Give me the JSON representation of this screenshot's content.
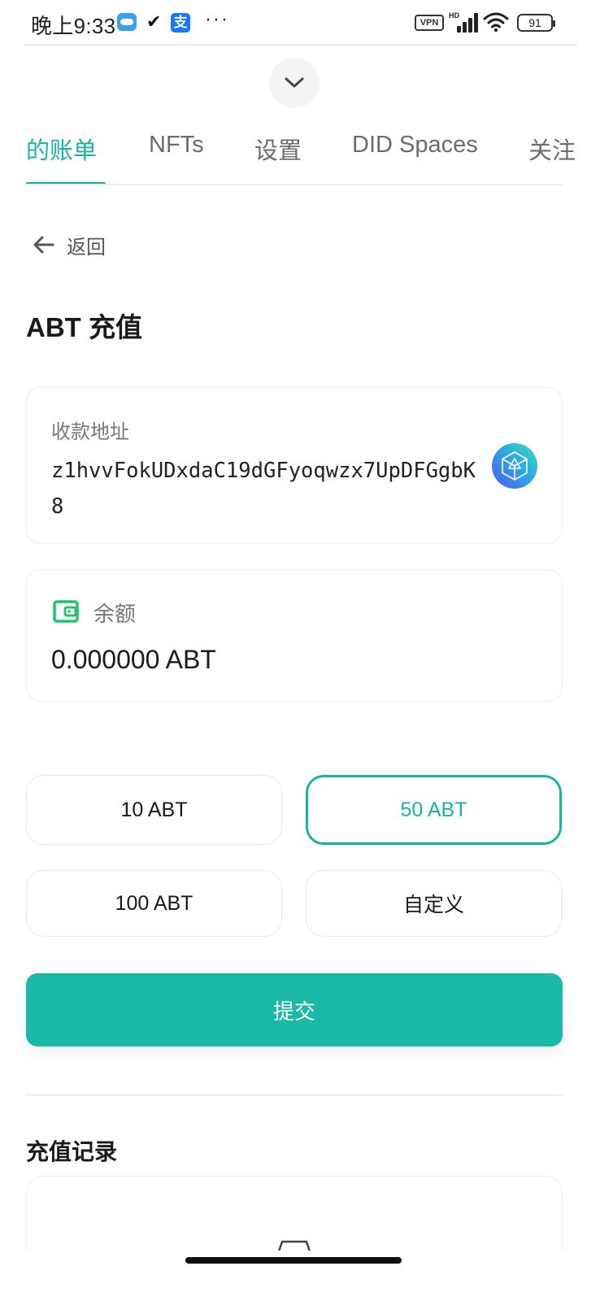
{
  "status_bar": {
    "time": "晚上9:33",
    "alipay_glyph": "支",
    "vpn": "VPN",
    "hd": "HD",
    "battery": "91"
  },
  "tabs": [
    {
      "label": "的账单",
      "active": true
    },
    {
      "label": "NFTs",
      "active": false
    },
    {
      "label": "设置",
      "active": false
    },
    {
      "label": "DID Spaces",
      "active": false
    },
    {
      "label": "关注",
      "active": false
    }
  ],
  "back_label": "返回",
  "page_title": "ABT 充值",
  "address": {
    "label": "收款地址",
    "value": "z1hvvFokUDxdaC19dGFyoqwzx7UpDFGgbK8"
  },
  "balance": {
    "label": "余额",
    "value": "0.000000 ABT"
  },
  "amount_options": [
    {
      "label": "10 ABT",
      "selected": false
    },
    {
      "label": "50 ABT",
      "selected": true
    },
    {
      "label": "100 ABT",
      "selected": false
    },
    {
      "label": "自定义",
      "selected": false
    }
  ],
  "submit_label": "提交",
  "history_title": "充值记录",
  "colors": {
    "accent": "#19b3a3",
    "submit": "#1ab8a6",
    "wallet_icon": "#22c36a"
  },
  "icons": {
    "collapse": "chevron-down-icon",
    "back": "arrow-left-icon",
    "address": "did-icon",
    "balance": "wallet-icon",
    "history_empty": "empty-box-icon"
  }
}
